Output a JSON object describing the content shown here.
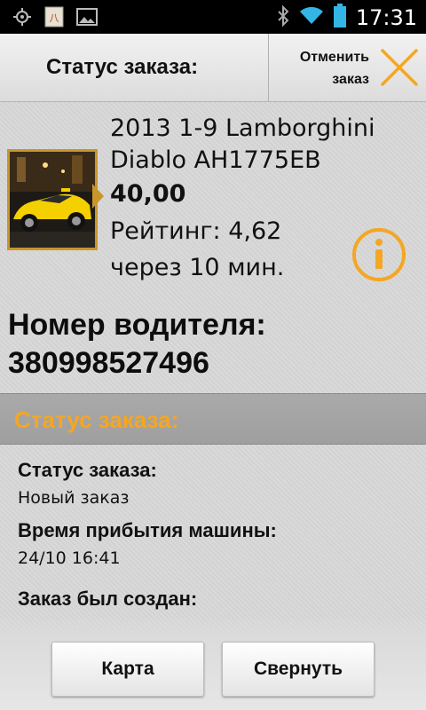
{
  "status_bar": {
    "time": "17:31",
    "icons": [
      "gps-icon",
      "app-notification-icon",
      "image-icon",
      "bluetooth-icon",
      "wifi-icon",
      "battery-icon"
    ]
  },
  "header": {
    "title": "Статус заказа:",
    "cancel_label_line1": "Отменить",
    "cancel_label_line2": "заказ",
    "cancel_icon": "close-x-icon"
  },
  "car": {
    "name": "2013 1-9 Lamborghini Diablo AH1775EB",
    "price": "40,00",
    "rating": "Рейтинг: 4,62",
    "eta": "через 10 мин.",
    "thumbnail": "yellow-car-photo",
    "info_icon": "info-icon"
  },
  "driver": {
    "label": "Номер водителя:",
    "phone": "380998527496"
  },
  "section": {
    "title": "Статус заказа:"
  },
  "details": [
    {
      "label": "Статус заказа:",
      "value": "Новый заказ"
    },
    {
      "label": "Время прибытия машины:",
      "value": "24/10 16:41"
    },
    {
      "label": "Заказ был создан:",
      "value": ""
    }
  ],
  "buttons": {
    "map": "Карта",
    "collapse": "Свернуть"
  },
  "colors": {
    "accent": "#f5a623",
    "thumb_border": "#c8962a"
  }
}
